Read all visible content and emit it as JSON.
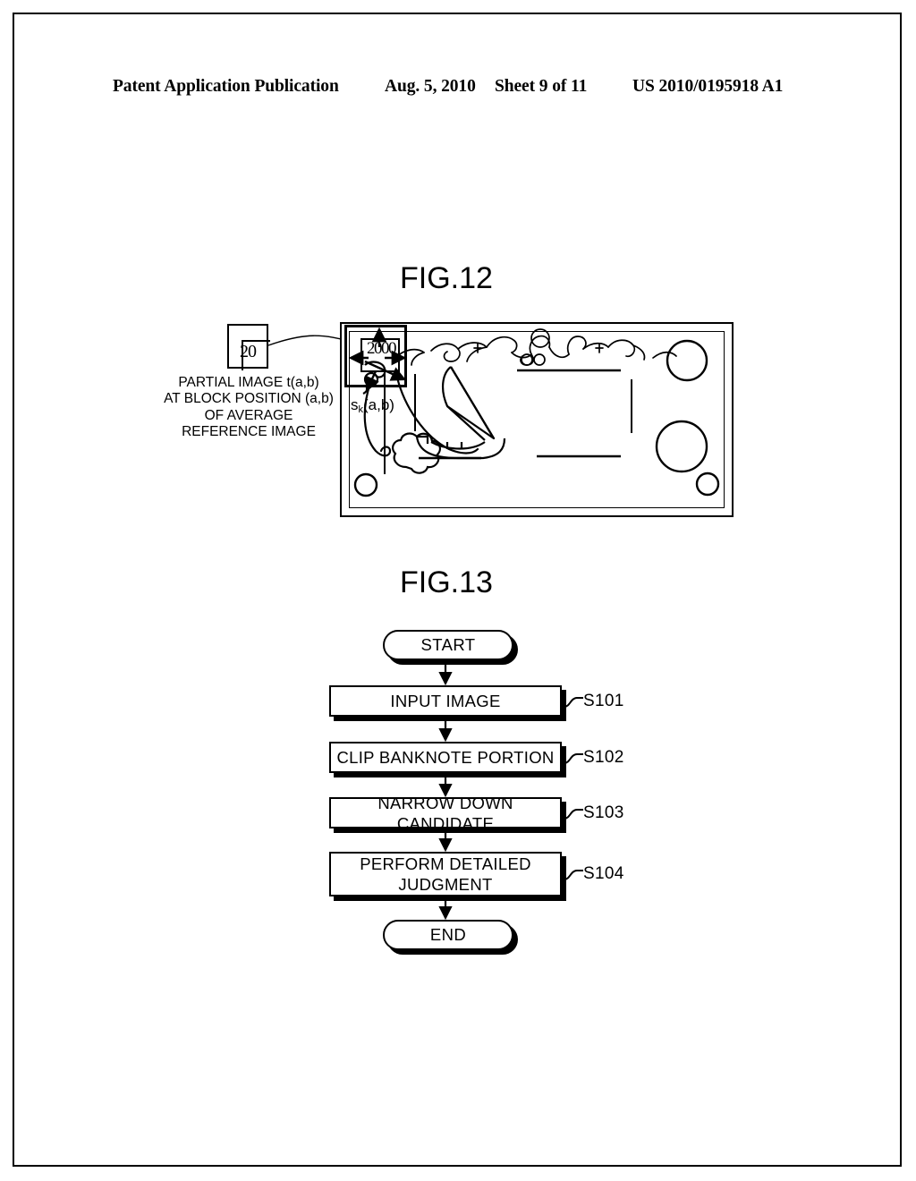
{
  "header": {
    "publication": "Patent Application Publication",
    "date": "Aug. 5, 2010",
    "sheet": "Sheet 9 of 11",
    "patent_number": "US 2010/0195918 A1"
  },
  "fig12": {
    "title": "FIG.12",
    "partial_box_value": "20",
    "caption": "PARTIAL IMAGE t(a,b)\nAT BLOCK POSITION (a,b)\nOF AVERAGE\nREFERENCE IMAGE",
    "block_denomination": "2000",
    "block_label": "s",
    "block_label_sub": "k",
    "block_label_args": "(a,b)"
  },
  "fig13": {
    "title": "FIG.13",
    "nodes": [
      {
        "id": "start",
        "shape": "terminal",
        "label": "START",
        "tag": ""
      },
      {
        "id": "s101",
        "shape": "process",
        "label": "INPUT IMAGE",
        "tag": "S101"
      },
      {
        "id": "s102",
        "shape": "process",
        "label": "CLIP BANKNOTE PORTION",
        "tag": "S102"
      },
      {
        "id": "s103",
        "shape": "process",
        "label": "NARROW DOWN CANDIDATE",
        "tag": "S103"
      },
      {
        "id": "s104",
        "shape": "process",
        "label": "PERFORM DETAILED\nJUDGMENT",
        "tag": "S104"
      },
      {
        "id": "end",
        "shape": "terminal",
        "label": "END",
        "tag": ""
      }
    ]
  },
  "colors": {
    "ink": "#000000",
    "paper": "#ffffff"
  }
}
